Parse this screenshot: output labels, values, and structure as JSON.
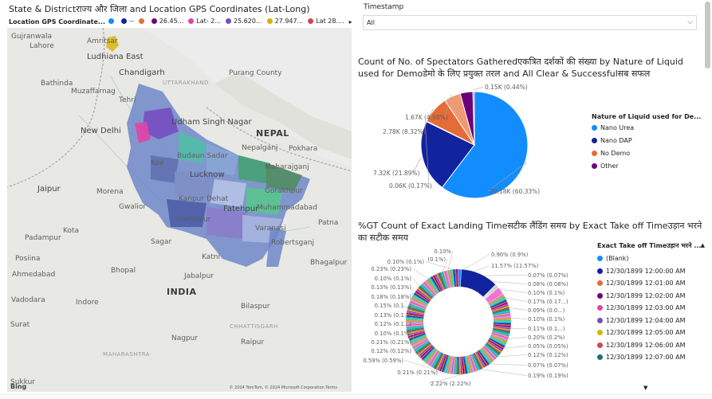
{
  "map": {
    "title": "State & Districtराज्य और जिला and Location GPS Coordinates (Lat-Long)",
    "legend_title": "Location GPS Coordinate...",
    "legend_items": [
      {
        "label": "",
        "color": "#118DFF"
      },
      {
        "label": "--",
        "color": "#12239E"
      },
      {
        "label": "",
        "color": "#E66C37"
      },
      {
        "label": "26.45...",
        "color": "#6B007B"
      },
      {
        "label": "Lat- 2...",
        "color": "#E044A7"
      },
      {
        "label": "25.620...",
        "color": "#744EC2"
      },
      {
        "label": "27.947...",
        "color": "#D9B300"
      },
      {
        "label": "Lat 28....",
        "color": "#D64550"
      }
    ],
    "legend_more": "▸",
    "attribution": "© 2024 TomTom, © 2024 Microsoft Corporation  Terms",
    "bing": "Bing",
    "labels": [
      {
        "text": "Lahore",
        "name": "map-label-lahore"
      },
      {
        "text": "Amritsar",
        "name": "map-label-amritsar"
      },
      {
        "text": "Ludhiana East",
        "name": "map-label-ludhiana-east"
      },
      {
        "text": "Chandigarh",
        "name": "map-label-chandigarh"
      },
      {
        "text": "Bathinda",
        "name": "map-label-bathinda"
      },
      {
        "text": "Muzaffarnag",
        "name": "map-label-muzaffarnagar"
      },
      {
        "text": "Tehri",
        "name": "map-label-tehri"
      },
      {
        "text": "UTTARAKHAND",
        "name": "map-label-uttarakhand"
      },
      {
        "text": "Purang County",
        "name": "map-label-purang"
      },
      {
        "text": "New Delhi",
        "name": "map-label-new-delhi"
      },
      {
        "text": "Udham Singh Nagar",
        "name": "map-label-udham-singh-nagar"
      },
      {
        "text": "NEPAL",
        "name": "map-label-nepal"
      },
      {
        "text": "Nepalganj",
        "name": "map-label-nepalganj"
      },
      {
        "text": "Pokhara",
        "name": "map-label-pokhara"
      },
      {
        "text": "Koil",
        "name": "map-label-koil"
      },
      {
        "text": "Budaun Sadar",
        "name": "map-label-budaun-sadar"
      },
      {
        "text": "Lucknow",
        "name": "map-label-lucknow"
      },
      {
        "text": "Maharajganj",
        "name": "map-label-maharajganj"
      },
      {
        "text": "Jaipur",
        "name": "map-label-jaipur"
      },
      {
        "text": "Morena",
        "name": "map-label-morena"
      },
      {
        "text": "Kanpur Dehat",
        "name": "map-label-kanpur-dehat"
      },
      {
        "text": "Gorakhpur",
        "name": "map-label-gorakhpur"
      },
      {
        "text": "Gwalior",
        "name": "map-label-gwalior"
      },
      {
        "text": "Fatehpur",
        "name": "map-label-fatehpur"
      },
      {
        "text": "Muhammadabad",
        "name": "map-label-muhammadabad"
      },
      {
        "text": "Hamirpur",
        "name": "map-label-hamirpur"
      },
      {
        "text": "Varanasi",
        "name": "map-label-varanasi"
      },
      {
        "text": "Patna",
        "name": "map-label-patna"
      },
      {
        "text": "Padampur",
        "name": "map-label-padampur"
      },
      {
        "text": "Sagar",
        "name": "map-label-sagar"
      },
      {
        "text": "Robertsganj",
        "name": "map-label-robertsganj"
      },
      {
        "text": "Kota",
        "name": "map-label-kota"
      },
      {
        "text": "Katni",
        "name": "map-label-katni"
      },
      {
        "text": "Bhopal",
        "name": "map-label-bhopal"
      },
      {
        "text": "Jabalpur",
        "name": "map-label-jabalpur"
      },
      {
        "text": "Posiina",
        "name": "map-label-posiina"
      },
      {
        "text": "Vadodara",
        "name": "map-label-vadodara"
      },
      {
        "text": "Indore",
        "name": "map-label-indore"
      },
      {
        "text": "Bilaspur",
        "name": "map-label-bilaspur"
      },
      {
        "text": "CHHATTISGARH",
        "name": "map-label-chhattisgarh"
      },
      {
        "text": "Ahmedabad",
        "name": "map-label-ahmedabad"
      },
      {
        "text": "Raipur",
        "name": "map-label-raipur"
      },
      {
        "text": "Surat",
        "name": "map-label-surat"
      },
      {
        "text": "Nagpur",
        "name": "map-label-nagpur"
      },
      {
        "text": "MAHARASHTRA",
        "name": "map-label-maharashtra"
      },
      {
        "text": "INDIA",
        "name": "map-label-india"
      },
      {
        "text": "Sukkur",
        "name": "map-label-sukkur"
      },
      {
        "text": "Gujranwala",
        "name": "map-label-gujranwala"
      },
      {
        "text": "Bhagalpur",
        "name": "map-label-bhagalpur"
      }
    ]
  },
  "slicer": {
    "title": "Timestamp",
    "value": "All",
    "chevron": "⌵"
  },
  "pie": {
    "title": "Count of No. of Spectators Gatheredएकत्रित दर्शकों की संख्या by Nature of Liquid used for Demoडेमो के लिए प्रयुक्त तरल and All Clear & Successfulसब सफल",
    "legend_title": "Nature of Liquid used for De...",
    "legend": [
      {
        "label": "Nano Urea",
        "color": "#118DFF"
      },
      {
        "label": "Nano DAP",
        "color": "#12239E"
      },
      {
        "label": "No Demo",
        "color": "#E66C37"
      },
      {
        "label": "Other",
        "color": "#6B007B"
      }
    ]
  },
  "donut": {
    "title": "%GT Count of Exact Landing Timeसटीक लैंडिंग समय by Exact Take off Timeउड़ान भरने का सटीक समय",
    "legend_title": "Exact Take off Timeउड़ान भरने ...",
    "legend": [
      {
        "label": "(Blank)",
        "color": "#118DFF"
      },
      {
        "label": "12/30/1899 12:00:00 AM",
        "color": "#12239E"
      },
      {
        "label": "12/30/1899 12:01:00 AM",
        "color": "#E66C37"
      },
      {
        "label": "12/30/1899 12:02:00 AM",
        "color": "#6B007B"
      },
      {
        "label": "12/30/1899 12:03:00 AM",
        "color": "#E044A7"
      },
      {
        "label": "12/30/1899 12:04:00 AM",
        "color": "#744EC2"
      },
      {
        "label": "12/30/1899 12:05:00 AM",
        "color": "#D9B300"
      },
      {
        "label": "12/30/1899 12:06:00 AM",
        "color": "#D64550"
      },
      {
        "label": "12/30/1899 12:07:00 AM",
        "color": "#197278"
      }
    ],
    "legend_up": "▲",
    "legend_down": "▼"
  },
  "chart_data": [
    {
      "type": "pie",
      "title": "Count of No. of Spectators Gatheredएकत्रित दर्शकों की संख्या by Nature of Liquid used for Demoडेमो के लिए प्रयुक्त तरल and All Clear & Successfulसब सफल",
      "slices": [
        {
          "category": "Nano Urea",
          "value": 20.18,
          "display": "20.18K (60.33%)",
          "color": "#118DFF"
        },
        {
          "category": "Nano DAP",
          "value": 7.32,
          "display": "7.32K (21.89%)",
          "color": "#12239E"
        },
        {
          "category": "Nano DAP",
          "value": 0.06,
          "display": "0.06K (0.17%)",
          "color": "#4B6BC4"
        },
        {
          "category": "No Demo",
          "value": 2.78,
          "display": "2.78K (8.32%)",
          "color": "#E66C37"
        },
        {
          "category": "No Demo",
          "value": 1.67,
          "display": "1.67K (4.98%)",
          "color": "#EE9A73"
        },
        {
          "category": "Other",
          "value": 1.29,
          "display": "",
          "color": "#6B007B"
        },
        {
          "category": "Other",
          "value": 0.15,
          "display": "0.15K (0.44%)",
          "color": "#9C4FA8"
        }
      ],
      "legend_position": "right"
    },
    {
      "type": "pie",
      "subtype": "donut",
      "title": "%GT Count of Exact Landing Timeसटीक लैंडिंग समय by Exact Take off Timeउड़ान भरने का सटीक समय",
      "labels": [
        {
          "text": "0.90% (0.9%)",
          "side": "right"
        },
        {
          "text": "11.57% (11.57%)",
          "side": "right"
        },
        {
          "text": "0.07% (0.07%)",
          "side": "right"
        },
        {
          "text": "0.08% (0.08%)",
          "side": "right"
        },
        {
          "text": "0.10% (0.1%)",
          "side": "right"
        },
        {
          "text": "0.17% (0.17...)",
          "side": "right"
        },
        {
          "text": "0.09% (0.0...)",
          "side": "right"
        },
        {
          "text": "0.10% (0.1%)",
          "side": "right"
        },
        {
          "text": "0.11% (0.1...)",
          "side": "right"
        },
        {
          "text": "0.20% (0.2%)",
          "side": "right"
        },
        {
          "text": "0.05% (0.05%)",
          "side": "right"
        },
        {
          "text": "0.12% (0.12%)",
          "side": "right"
        },
        {
          "text": "0.07% (0.07%)",
          "side": "right"
        },
        {
          "text": "0.19% (0.19%)",
          "side": "right"
        },
        {
          "text": "2.22% (2.22%)",
          "side": "bottom"
        },
        {
          "text": "0.21% (0.21%)",
          "side": "left"
        },
        {
          "text": "0.59% (0.59%)",
          "side": "left"
        },
        {
          "text": "0.12% (0.12%)",
          "side": "left"
        },
        {
          "text": "0.21% (0.21%)",
          "side": "left"
        },
        {
          "text": "0.10% (0.1%)",
          "side": "left"
        },
        {
          "text": "0.12% (0.1...)",
          "side": "left"
        },
        {
          "text": "0.13% (0.1...)",
          "side": "left"
        },
        {
          "text": "0.15% (0.1...)",
          "side": "left"
        },
        {
          "text": "0.18% (0.18%)",
          "side": "left"
        },
        {
          "text": "0.13% (0.13%)",
          "side": "left"
        },
        {
          "text": "0.10% (0.1%)",
          "side": "left"
        },
        {
          "text": "0.23% (0.23%)",
          "side": "left"
        },
        {
          "text": "0.10% (0.1%)",
          "side": "top"
        },
        {
          "text": "0.10%",
          "side": "top"
        },
        {
          "text": "(0.1%)",
          "side": "top"
        }
      ],
      "legend_position": "right"
    }
  ]
}
